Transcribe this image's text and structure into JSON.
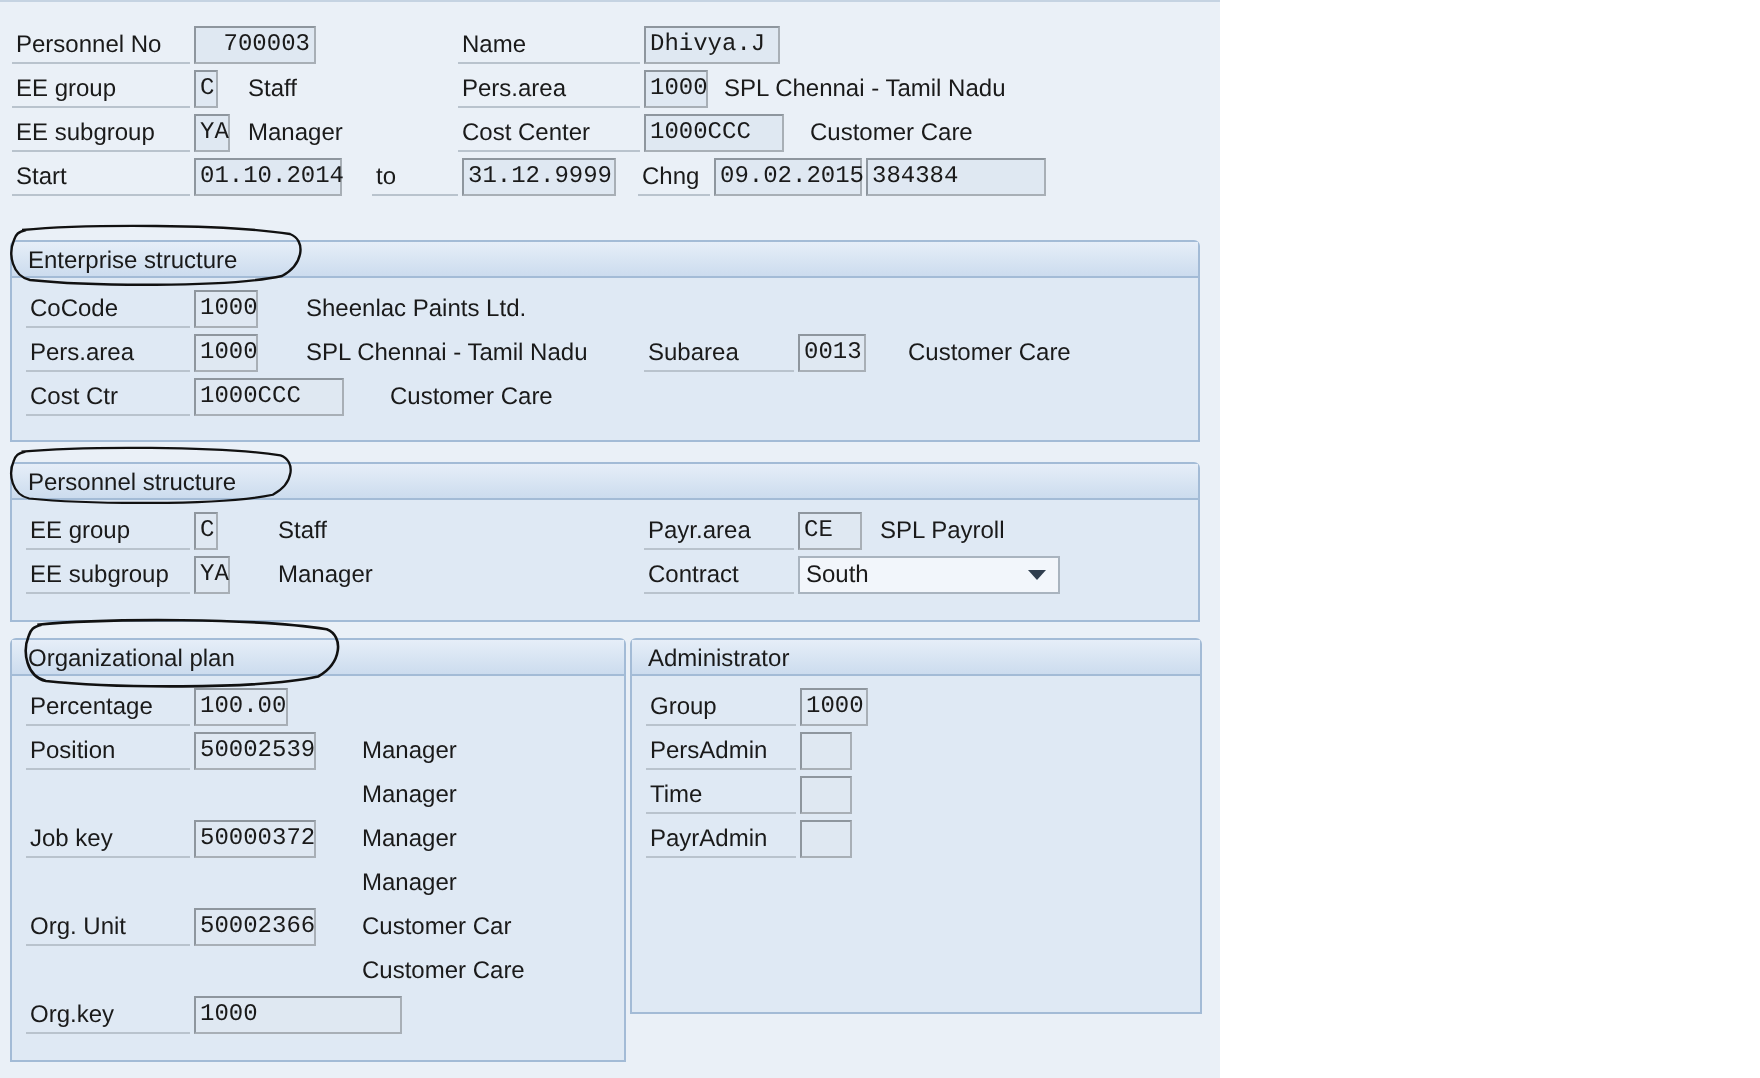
{
  "header": {
    "rows": [
      [
        {
          "label": "Personnel No",
          "fields": [
            {
              "kind": "field",
              "value": "700003"
            }
          ]
        },
        {
          "label": "Name",
          "fields": [
            {
              "kind": "field",
              "value": "Dhivya.J"
            }
          ]
        }
      ],
      [
        {
          "label": "EE group",
          "fields": [
            {
              "kind": "field",
              "value": "C"
            }
          ],
          "text": "Staff"
        },
        {
          "label": "Pers.area",
          "fields": [
            {
              "kind": "field",
              "value": "1000"
            }
          ],
          "text": "SPL Chennai - Tamil Nadu"
        }
      ],
      [
        {
          "label": "EE subgroup",
          "fields": [
            {
              "kind": "field",
              "value": "YA"
            }
          ],
          "text": "Manager"
        },
        {
          "label": "Cost Center",
          "fields": [
            {
              "kind": "field",
              "value": "1000CCC"
            }
          ],
          "text": "Customer Care"
        }
      ],
      [
        {
          "label": "Start",
          "fields": [
            {
              "kind": "field",
              "value": "01.10.2014"
            }
          ]
        },
        {
          "label": "to",
          "fields": [
            {
              "kind": "field",
              "value": "31.12.9999"
            }
          ]
        },
        {
          "label": "Chng",
          "fields": [
            {
              "kind": "field",
              "value": "09.02.2015"
            },
            {
              "kind": "field",
              "value": "384384"
            }
          ]
        }
      ]
    ]
  },
  "groups": [
    {
      "title": "Enterprise structure",
      "circled": true,
      "rows": [
        [
          {
            "label": "CoCode",
            "fields": [
              {
                "kind": "field",
                "value": "1000"
              }
            ],
            "text": "Sheenlac Paints Ltd."
          }
        ],
        [
          {
            "label": "Pers.area",
            "fields": [
              {
                "kind": "field",
                "value": "1000"
              }
            ],
            "text": "SPL Chennai - Tamil Nadu"
          },
          {
            "label": "Subarea",
            "fields": [
              {
                "kind": "field",
                "value": "0013"
              }
            ],
            "text": "Customer Care"
          }
        ],
        [
          {
            "label": "Cost Ctr",
            "fields": [
              {
                "kind": "field",
                "value": "1000CCC"
              }
            ],
            "text": "Customer Care"
          }
        ]
      ]
    },
    {
      "title": "Personnel structure",
      "circled": true,
      "rows": [
        [
          {
            "label": "EE group",
            "fields": [
              {
                "kind": "field",
                "value": "C"
              }
            ],
            "text": "Staff"
          },
          {
            "label": "Payr.area",
            "fields": [
              {
                "kind": "field",
                "value": "CE"
              }
            ],
            "text": "SPL Payroll"
          }
        ],
        [
          {
            "label": "EE subgroup",
            "fields": [
              {
                "kind": "field",
                "value": "YA"
              }
            ],
            "text": "Manager"
          },
          {
            "label": "Contract",
            "fields": [
              {
                "kind": "dropdown",
                "value": "South"
              }
            ]
          }
        ]
      ]
    },
    {
      "title": "Organizational plan",
      "circled": true,
      "rows": [
        [
          {
            "label": "Percentage",
            "fields": [
              {
                "kind": "field",
                "value": "100.00"
              }
            ]
          }
        ],
        [
          {
            "label": "Position",
            "fields": [
              {
                "kind": "field",
                "value": "50002539"
              }
            ],
            "text": "Manager"
          }
        ],
        [
          {
            "text": "Manager"
          }
        ],
        [
          {
            "label": "Job key",
            "fields": [
              {
                "kind": "field",
                "value": "50000372"
              }
            ],
            "text": "Manager"
          }
        ],
        [
          {
            "text": "Manager"
          }
        ],
        [
          {
            "label": "Org. Unit",
            "fields": [
              {
                "kind": "field",
                "value": "50002366"
              }
            ],
            "text": "Customer Car"
          }
        ],
        [
          {
            "text": "Customer Care"
          }
        ],
        [
          {
            "label": "Org.key",
            "fields": [
              {
                "kind": "field",
                "value": "1000"
              }
            ]
          }
        ]
      ]
    },
    {
      "title": "Administrator",
      "circled": false,
      "rows": [
        [
          {
            "label": "Group",
            "fields": [
              {
                "kind": "field",
                "value": "1000"
              }
            ]
          }
        ],
        [
          {
            "label": "PersAdmin",
            "fields": [
              {
                "kind": "field"
              }
            ]
          }
        ],
        [
          {
            "label": "Time",
            "fields": [
              {
                "kind": "field"
              }
            ]
          }
        ],
        [
          {
            "label": "PayrAdmin",
            "fields": [
              {
                "kind": "field"
              }
            ]
          }
        ]
      ]
    }
  ]
}
